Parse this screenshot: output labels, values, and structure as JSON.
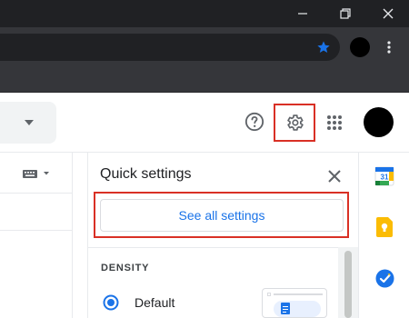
{
  "window": {
    "controls": [
      "minimize-icon",
      "restore-icon",
      "close-icon"
    ]
  },
  "browser": {
    "bookmark_icon": "star-icon",
    "menu_icon": "more-vert-icon"
  },
  "gmail_header": {
    "help_icon": "help-icon",
    "settings_icon": "gear-icon",
    "apps_icon": "apps-grid-icon"
  },
  "quick_settings": {
    "title": "Quick settings",
    "see_all_label": "See all settings",
    "density_heading": "DENSITY",
    "density_options": [
      {
        "label": "Default",
        "selected": true
      }
    ]
  },
  "side_apps": [
    "calendar-icon",
    "keep-icon",
    "tasks-icon"
  ],
  "calendar_day": "31",
  "colors": {
    "accent": "#1a73e8",
    "highlight": "#d93025",
    "chrome_dark": "#202124",
    "chrome_mid": "#35363a"
  }
}
